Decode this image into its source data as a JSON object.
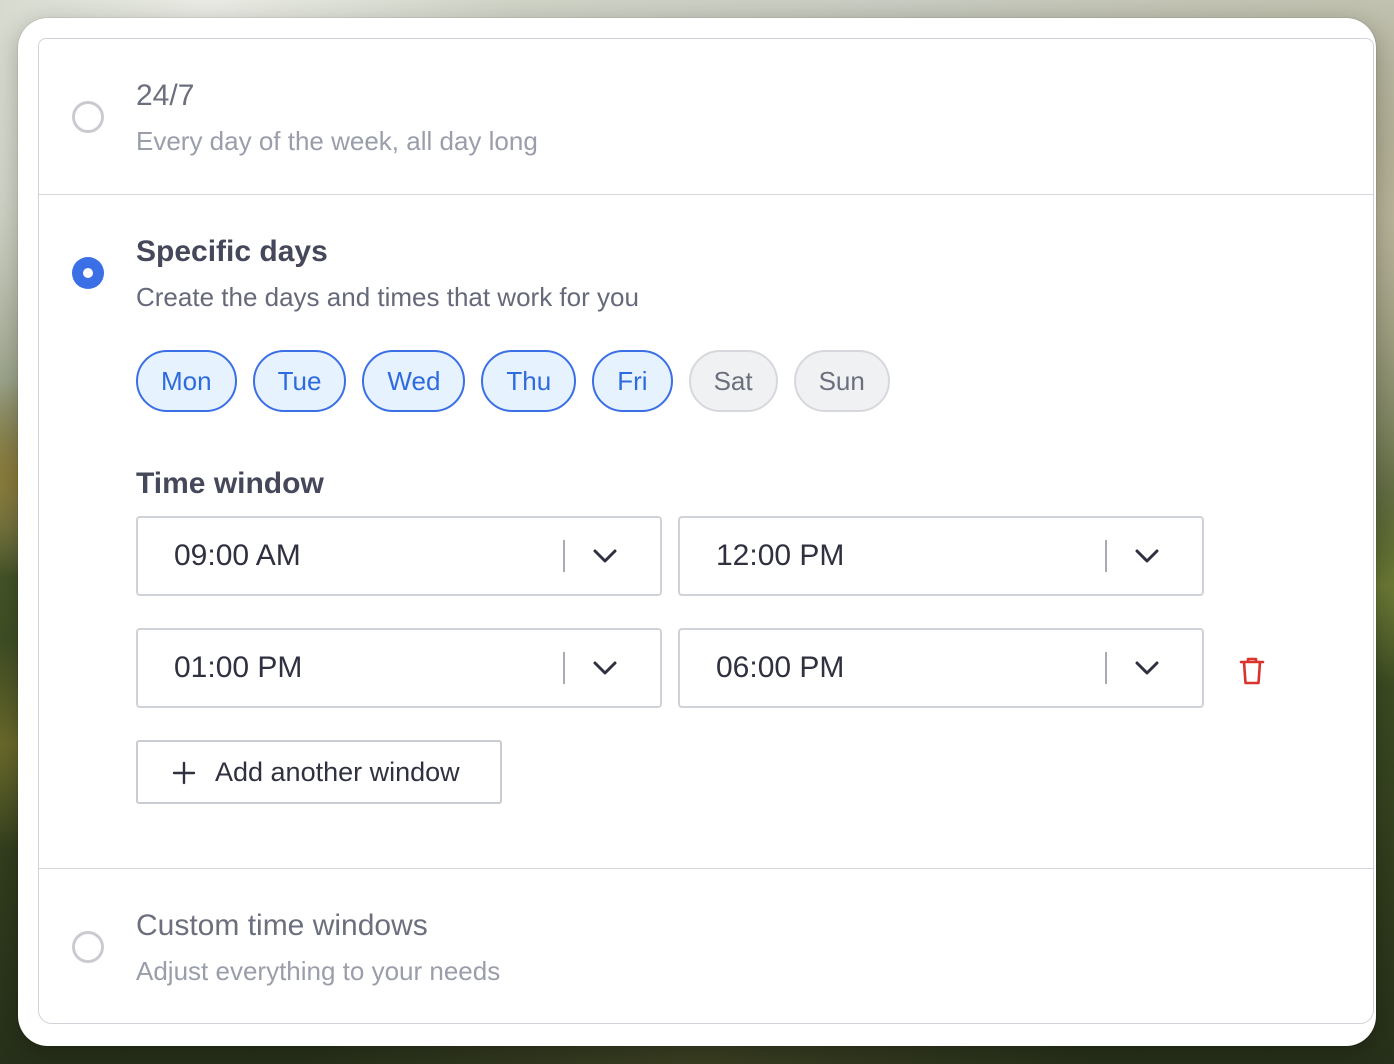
{
  "options": [
    {
      "title": "24/7",
      "description": "Every day of the week, all day long",
      "selected": false
    },
    {
      "title": "Specific days",
      "description": "Create the days and times that work for you",
      "selected": true
    },
    {
      "title": "Custom time windows",
      "description": "Adjust everything to your needs",
      "selected": false
    }
  ],
  "days": [
    {
      "label": "Mon",
      "selected": true
    },
    {
      "label": "Tue",
      "selected": true
    },
    {
      "label": "Wed",
      "selected": true
    },
    {
      "label": "Thu",
      "selected": true
    },
    {
      "label": "Fri",
      "selected": true
    },
    {
      "label": "Sat",
      "selected": false
    },
    {
      "label": "Sun",
      "selected": false
    }
  ],
  "time_window": {
    "label": "Time window",
    "windows": [
      {
        "start": "09:00 AM",
        "end": "12:00 PM",
        "deletable": false
      },
      {
        "start": "01:00 PM",
        "end": "06:00 PM",
        "deletable": true
      }
    ],
    "add_label": "Add another window"
  },
  "colors": {
    "accent": "#3b6fe6",
    "selected_day_bg": "#e6f2fd",
    "delete": "#d9332b"
  },
  "icons": {
    "chevron": "chevron-down-icon",
    "delete": "trash-icon",
    "add": "plus-icon"
  }
}
